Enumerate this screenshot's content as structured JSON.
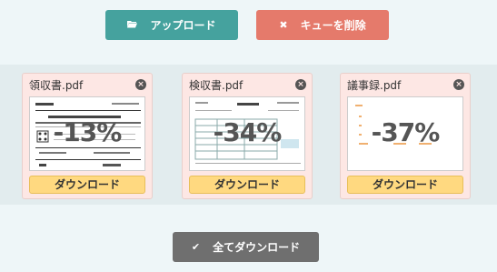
{
  "toolbar": {
    "upload_label": "アップロード",
    "clear_label": "キューを削除",
    "upload_icon": "folder-open-icon",
    "clear_icon": "x-icon"
  },
  "files": [
    {
      "name": "領収書.pdf",
      "ratio": "-13%",
      "download_label": "ダウンロード"
    },
    {
      "name": "検収書.pdf",
      "ratio": "-34%",
      "download_label": "ダウンロード"
    },
    {
      "name": "議事録.pdf",
      "ratio": "-37%",
      "download_label": "ダウンロード"
    }
  ],
  "footer": {
    "download_all_label": "全てダウンロード",
    "download_all_icon": "checkmark-icon"
  },
  "colors": {
    "upload": "#45a29e",
    "clear": "#e57a6b",
    "download_all": "#6f6f6f",
    "card_bg": "#fde7e4",
    "download_btn": "#ffd980"
  }
}
